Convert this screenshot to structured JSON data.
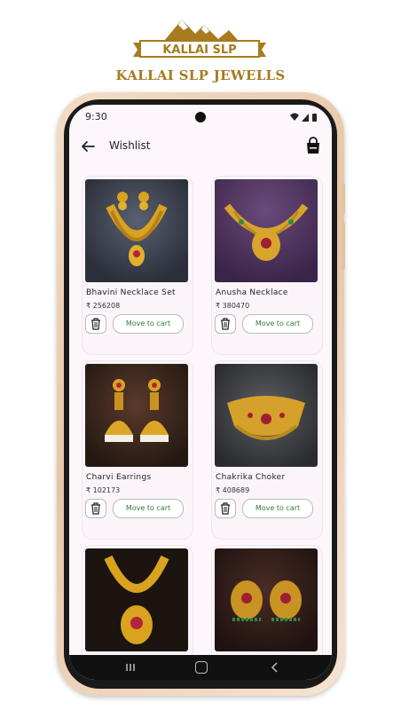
{
  "brand": {
    "logo_text": "KALLAI SLP",
    "name": "KALLAI SLP JEWELLS",
    "color": "#a77b1e"
  },
  "status_bar": {
    "time": "9:30"
  },
  "app_bar": {
    "title": "Wishlist",
    "back_icon": "arrow-left-icon",
    "bag_icon": "shopping-bag-icon"
  },
  "products": [
    {
      "name": "Bhavini Necklace Set",
      "price": "₹ 256208",
      "action": "Move to cart"
    },
    {
      "name": "Anusha Necklace",
      "price": "₹ 380470",
      "action": "Move to cart"
    },
    {
      "name": "Charvi Earrings",
      "price": "₹ 102173",
      "action": "Move to cart"
    },
    {
      "name": "Chakrika Choker",
      "price": "₹ 408689",
      "action": "Move to cart"
    },
    {
      "name": "",
      "price": "",
      "action": ""
    },
    {
      "name": "",
      "price": "",
      "action": ""
    }
  ],
  "colors": {
    "action_text": "#2f7d3a",
    "screen_bg": "#fdf7fb"
  }
}
